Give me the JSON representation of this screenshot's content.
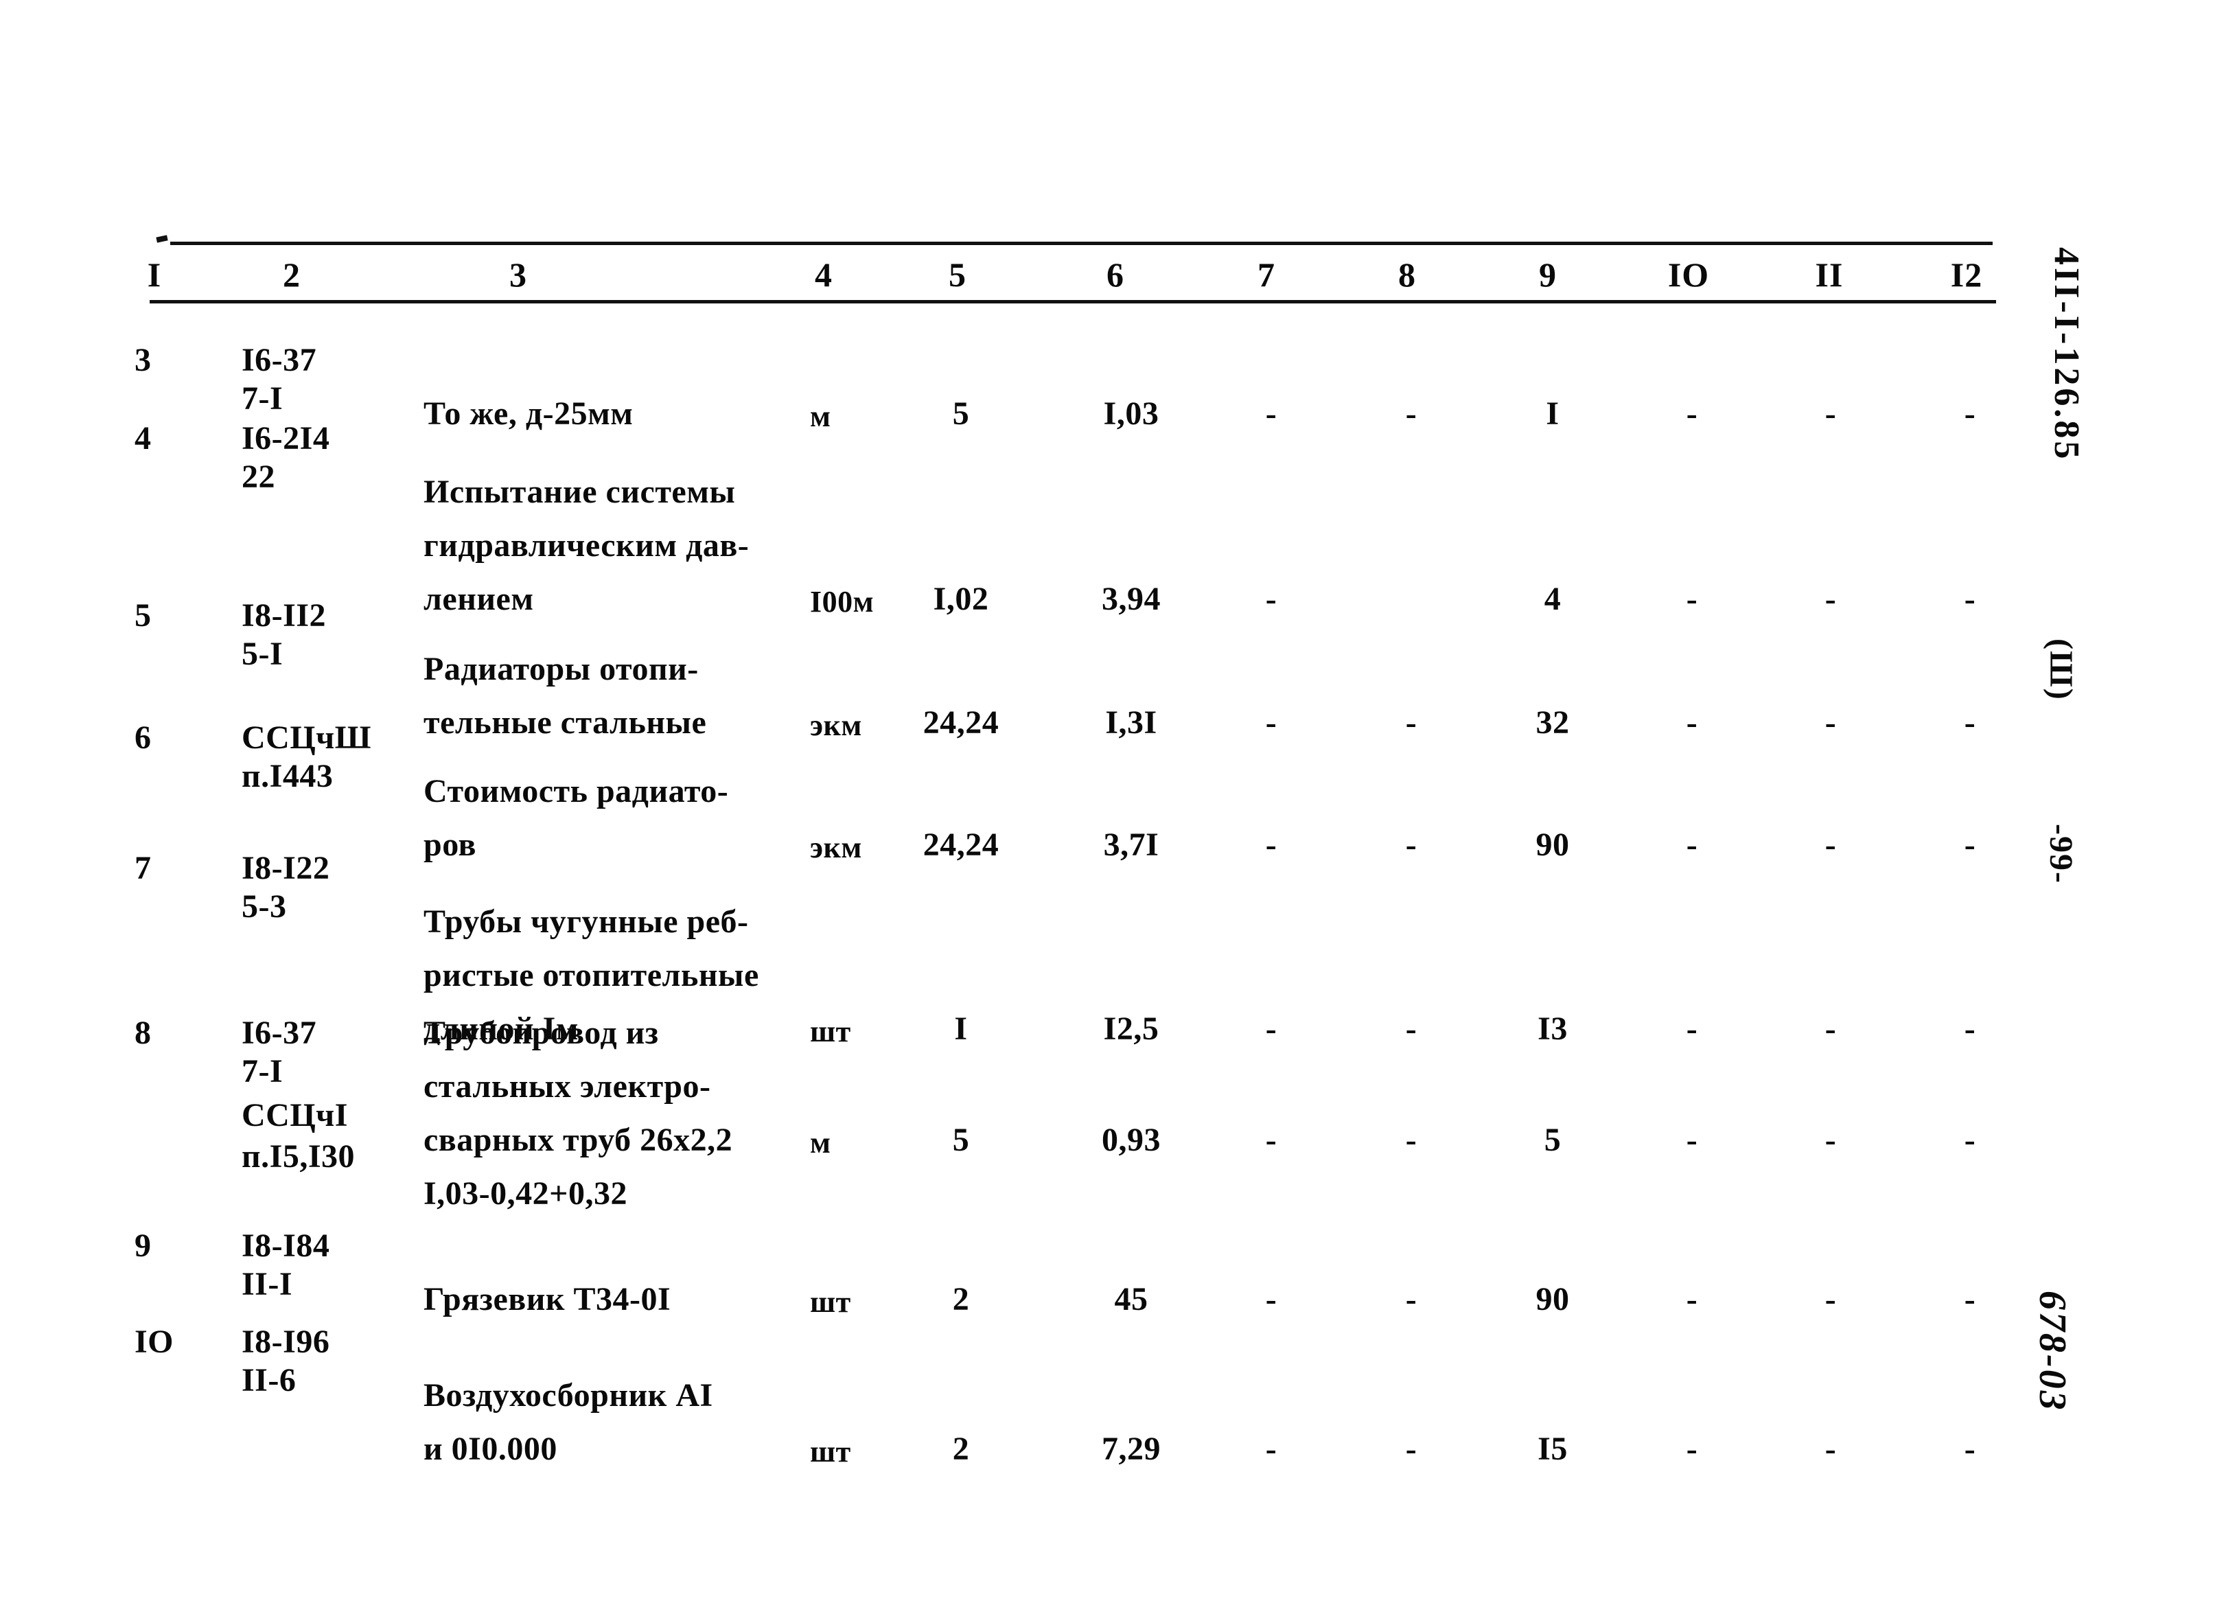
{
  "document": {
    "sheet_code": "4II-I-126.85",
    "section_mark": "(Ш)",
    "page_number": "-99-",
    "archive_number": "678-03"
  },
  "table": {
    "column_headers": [
      "I",
      "2",
      "3",
      "4",
      "5",
      "6",
      "7",
      "8",
      "9",
      "IO",
      "II",
      "I2"
    ],
    "rows": [
      {
        "num": "3",
        "code_lines": [
          "I6-37",
          "7-I"
        ],
        "desc_lines": [
          "То же, д-25мм"
        ],
        "unit": "м",
        "c5": "5",
        "c6": "I,03",
        "c7": "-",
        "c8": "-",
        "c9": "I",
        "c10": "-",
        "c11": "-",
        "c12": "-"
      },
      {
        "num": "4",
        "code_lines": [
          "I6-2I4",
          "22"
        ],
        "desc_lines": [
          "Испытание системы",
          "гидравлическим дав-",
          "лением"
        ],
        "unit": "I00м",
        "c5": "I,02",
        "c6": "3,94",
        "c7": "-",
        "c8": "",
        "c9": "4",
        "c10": "-",
        "c11": "-",
        "c12": "-"
      },
      {
        "num": "5",
        "code_lines": [
          "I8-II2",
          "5-I"
        ],
        "desc_lines": [
          "Радиаторы отопи-",
          "тельные стальные"
        ],
        "unit": "экм",
        "c5": "24,24",
        "c6": "I,3I",
        "c7": "-",
        "c8": "-",
        "c9": "32",
        "c10": "-",
        "c11": "-",
        "c12": "-"
      },
      {
        "num": "6",
        "code_lines": [
          "ССЦчШ",
          "п.I443"
        ],
        "desc_lines": [
          "Стоимость радиато-",
          "ров"
        ],
        "unit": "экм",
        "c5": "24,24",
        "c6": "3,7I",
        "c7": "-",
        "c8": "-",
        "c9": "90",
        "c10": "-",
        "c11": "-",
        "c12": "-"
      },
      {
        "num": "7",
        "code_lines": [
          "I8-I22",
          "5-3"
        ],
        "desc_lines": [
          "Трубы чугунные реб-",
          "ристые отопительные",
          "длиной Iм"
        ],
        "unit": "шт",
        "c5": "I",
        "c6": "I2,5",
        "c7": "-",
        "c8": "-",
        "c9": "I3",
        "c10": "-",
        "c11": "-",
        "c12": "-"
      },
      {
        "num": "8",
        "code_lines": [
          "I6-37",
          "7-I",
          "ССЦчI",
          "п.I5,I30"
        ],
        "desc_lines": [
          "Трубопровод из",
          "стальных электро-",
          "сварных труб 26х2,2",
          "I,03-0,42+0,32"
        ],
        "unit": "м",
        "c5": "5",
        "c6": "0,93",
        "c7": "-",
        "c8": "-",
        "c9": "5",
        "c10": "-",
        "c11": "-",
        "c12": "-"
      },
      {
        "num": "9",
        "code_lines": [
          "I8-I84",
          "II-I"
        ],
        "desc_lines": [
          "Грязевик Т34-0I"
        ],
        "unit": "шт",
        "c5": "2",
        "c6": "45",
        "c7": "-",
        "c8": "-",
        "c9": "90",
        "c10": "-",
        "c11": "-",
        "c12": "-"
      },
      {
        "num": "IO",
        "code_lines": [
          "I8-I96",
          "II-6"
        ],
        "desc_lines": [
          "Воздухосборник АI",
          "и 0I0.000"
        ],
        "unit": "шт",
        "c5": "2",
        "c6": "7,29",
        "c7": "-",
        "c8": "-",
        "c9": "I5",
        "c10": "-",
        "c11": "-",
        "c12": "-"
      }
    ]
  }
}
